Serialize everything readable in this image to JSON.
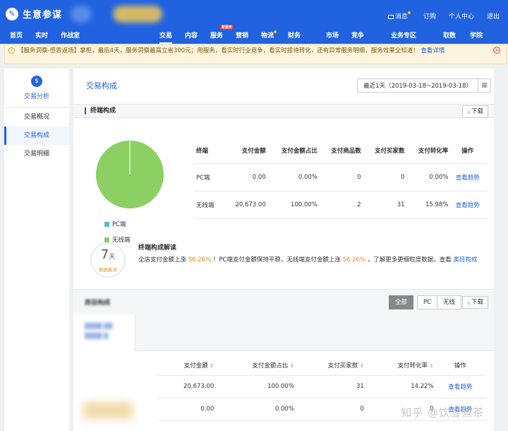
{
  "header": {
    "app_title": "生意参谋",
    "top_links": {
      "messages": "消息",
      "subscribe": "订购",
      "personal": "个人中心",
      "logout": "退出"
    },
    "nav": {
      "home": "首页",
      "realtime": "实时",
      "battle": "作战室",
      "trade": "交易",
      "content": "内容",
      "service": "服务",
      "service_badge": "新服务",
      "marketing": "营销",
      "logistics": "物流",
      "finance": "财务",
      "market": "市场",
      "competition": "竞争",
      "business": "业务专区",
      "data_fetch": "取数",
      "academy": "学院"
    }
  },
  "notice": {
    "text": "【服务洞察-感恩返场】掌柜，最后4天，服务洞察最高立省300元；用服务，看实时行业竞争，看实时接待转化，还有异常服务明细，服务效果全知道！",
    "link": "查看详情"
  },
  "sidebar": {
    "title": "交易分析",
    "items": [
      "交易概况",
      "交易构成",
      "交易明细"
    ],
    "active_index": 1
  },
  "main": {
    "page_title": "交易构成",
    "date_range": "最近1天（2019-03-18~2019-03-18）",
    "terminal_section_title": "终端构成",
    "download_label": "下载",
    "product_section_title": "类目构成",
    "segments": [
      "全部",
      "PC",
      "无线"
    ]
  },
  "legend": {
    "pc": "PC端",
    "wireless": "无线端"
  },
  "colors": {
    "pc": "#4fc0c4",
    "wireless": "#8ccf62",
    "accent": "#2062e0",
    "highlight": "#e8852a"
  },
  "terminal_table": {
    "headers": [
      "终端",
      "支付金额",
      "支付金额占比",
      "支付商品数",
      "支付买家数",
      "支付转化率",
      "操作"
    ],
    "rows": [
      [
        "PC端",
        "0.00",
        "0.00%",
        "0",
        "0",
        "0.00%",
        "查看趋势"
      ],
      [
        "无线端",
        "20,673.00",
        "100.00%",
        "2",
        "31",
        "15.98%",
        "查看趋势"
      ]
    ]
  },
  "interpretation": {
    "days": "7",
    "days_unit": "天",
    "days_sub": "数据解读",
    "title": "终端构成解读",
    "p1": "全店支付金额上涨",
    "v1": "56.26%",
    "p2": "！PC端支付金额保持平稳，无线端支付金额上涨",
    "v2": "56.26%",
    "p3": "，了解更多更细粒度数据，查看",
    "link": "类目构成"
  },
  "product_table": {
    "headers": [
      "支付金额",
      "支付金额占比",
      "支付买家数",
      "支付转化率",
      "操作"
    ],
    "rows": [
      [
        "20,673.00",
        "100.00%",
        "31",
        "14.22%",
        "查看趋势"
      ],
      [
        "0.00",
        "0.00%",
        "0",
        "0",
        "查看趋势"
      ]
    ]
  },
  "chart_data": {
    "type": "pie",
    "categories": [
      "PC端",
      "无线端"
    ],
    "values": [
      0.0,
      100.0
    ]
  },
  "watermark": "知乎 @饮雪煮茶"
}
